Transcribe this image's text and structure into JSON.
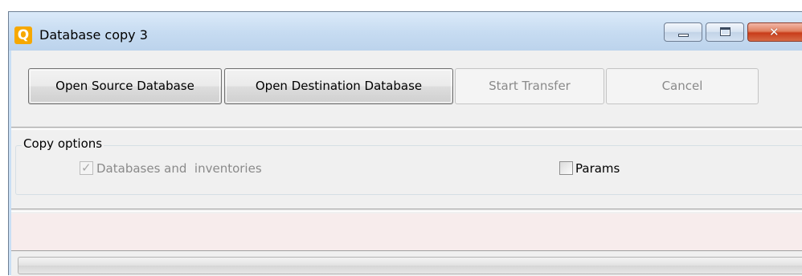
{
  "window": {
    "title": "Database copy 3",
    "app_icon_glyph": "Q",
    "app_icon_name": "app-logo-icon",
    "controls": {
      "minimize_icon": "minimize-icon",
      "maximize_icon": "maximize-icon",
      "close_icon": "close-icon",
      "close_glyph": "✕"
    }
  },
  "toolbar": {
    "open_source_label": "Open Source Database",
    "open_destination_label": "Open Destination Database",
    "start_transfer_label": "Start Transfer",
    "cancel_label": "Cancel"
  },
  "copy_options": {
    "group_title": "Copy options",
    "databases_inventories": {
      "label": "Databases and  inventories",
      "checked": true,
      "enabled": false
    },
    "params": {
      "label": "Params",
      "checked": false,
      "enabled": true
    }
  },
  "progress": {
    "value": 0
  },
  "colors": {
    "title_bar": "#c6dbf1",
    "close_button": "#c83c1a",
    "log_area_bg": "#f7ecec",
    "app_icon_bg": "#f6a800"
  }
}
